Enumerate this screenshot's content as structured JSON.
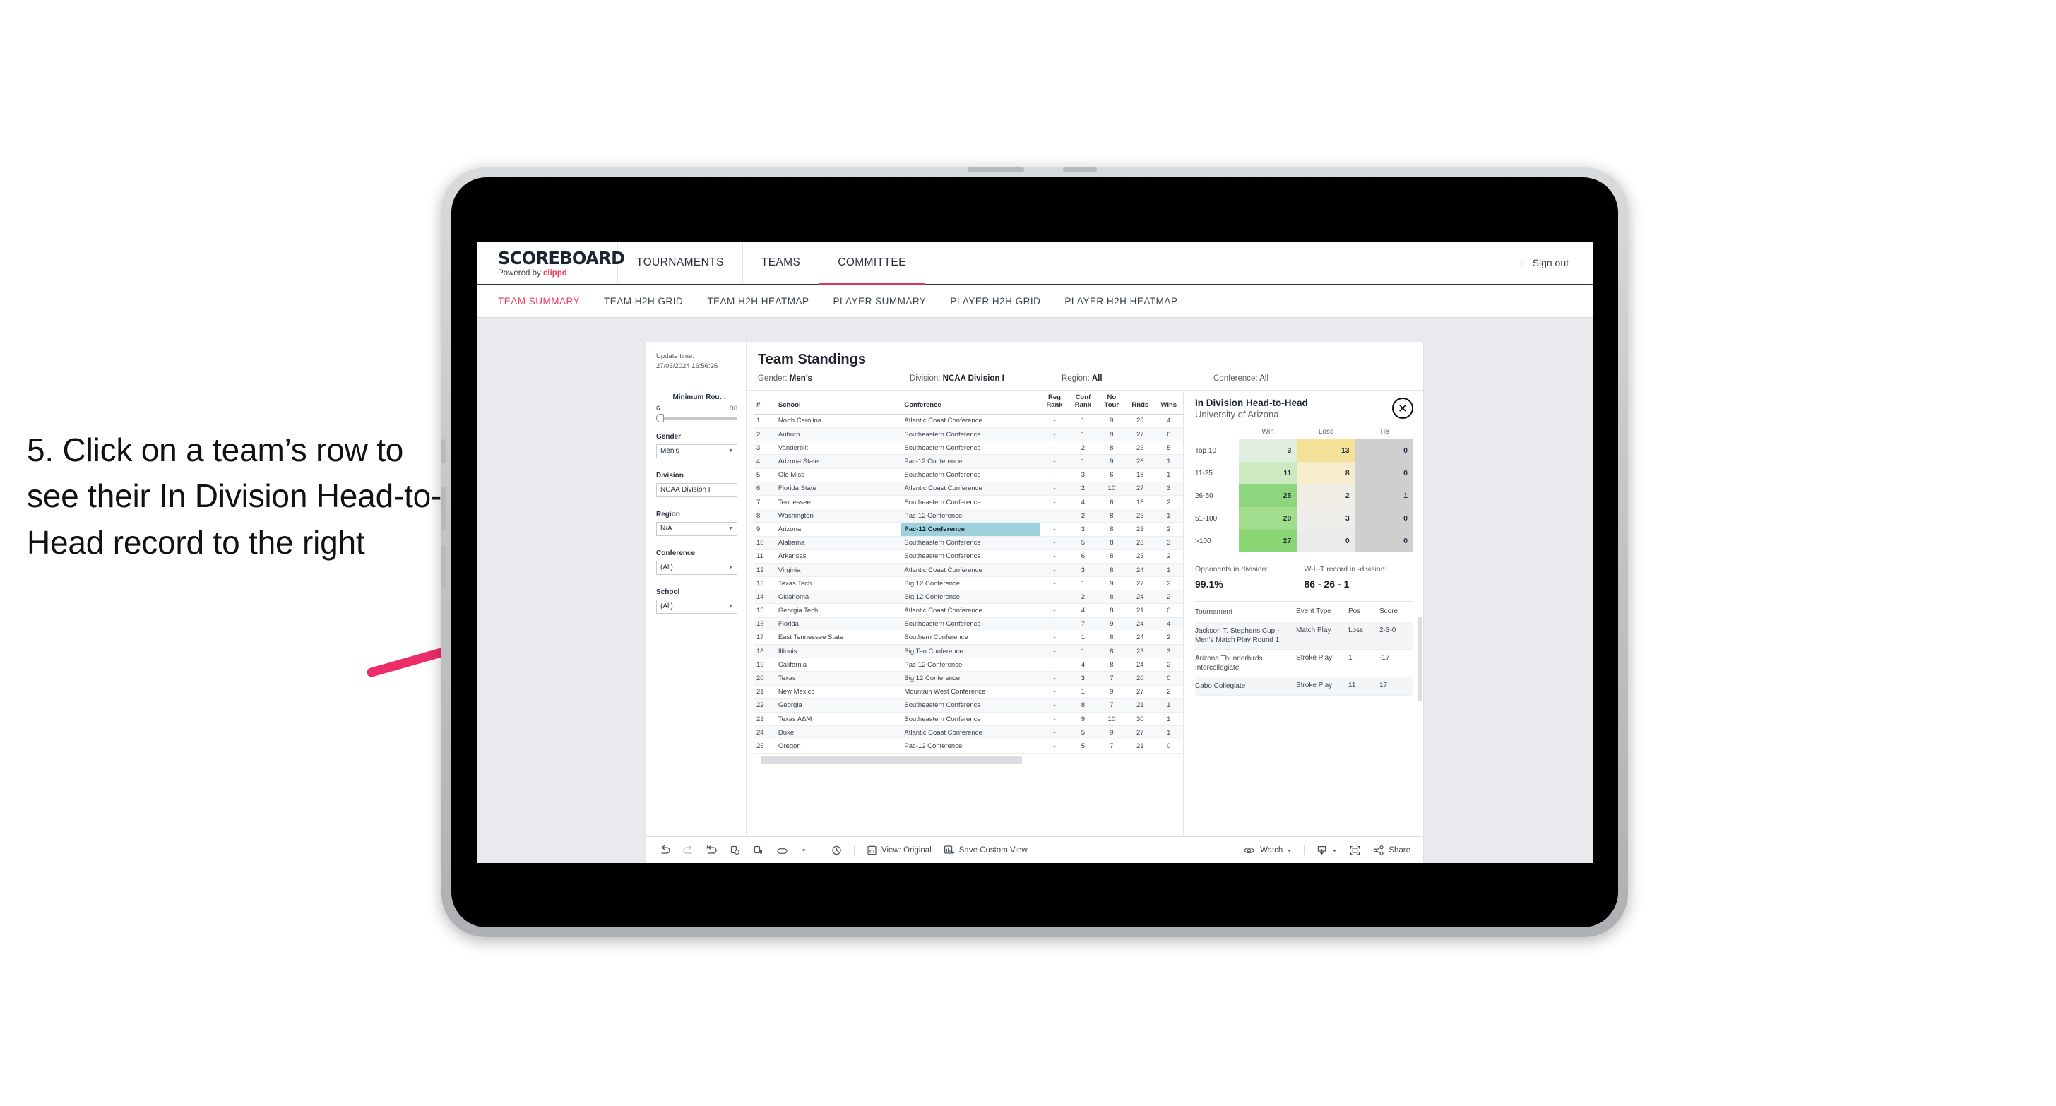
{
  "annotation": {
    "text": "5. Click on a team’s row to see their In Division Head-to-Head record to the right",
    "arrow_color": "#ee2d68"
  },
  "topnav": {
    "brand_name": "SCOREBOARD",
    "brand_sub_prefix": "Powered by ",
    "brand_sub_name": "clippd",
    "items": [
      {
        "label": "TOURNAMENTS",
        "active": false
      },
      {
        "label": "TEAMS",
        "active": false
      },
      {
        "label": "COMMITTEE",
        "active": true
      }
    ],
    "separator": "|",
    "sign_out": "Sign out",
    "accent": "#e03a58"
  },
  "subnav": {
    "items": [
      {
        "label": "TEAM SUMMARY",
        "active": true
      },
      {
        "label": "TEAM H2H GRID",
        "active": false
      },
      {
        "label": "TEAM H2H HEATMAP",
        "active": false
      },
      {
        "label": "PLAYER SUMMARY",
        "active": false
      },
      {
        "label": "PLAYER H2H GRID",
        "active": false
      },
      {
        "label": "PLAYER H2H HEATMAP",
        "active": false
      }
    ]
  },
  "sidebar": {
    "update_label": "Update time:",
    "update_value": "27/03/2024 16:56:26",
    "slider": {
      "title": "Minimum Rou…",
      "min": "6",
      "max": "30"
    },
    "filters": [
      {
        "label": "Gender",
        "value": "Men’s"
      },
      {
        "label": "Division",
        "value": "NCAA Division I"
      },
      {
        "label": "Region",
        "value": "N/A"
      },
      {
        "label": "Conference",
        "value": "(All)"
      },
      {
        "label": "School",
        "value": "(All)"
      }
    ]
  },
  "viz": {
    "title": "Team Standings",
    "filter_bar": [
      {
        "label": "Gender: ",
        "value": "Men’s",
        "bold": true
      },
      {
        "label": "Division: ",
        "value": "NCAA Division I",
        "bold": true
      },
      {
        "label": "Region: ",
        "value": "All",
        "bold": true
      },
      {
        "label": "Conference: ",
        "value": "All",
        "bold": false
      }
    ]
  },
  "table": {
    "columns": [
      "#",
      "School",
      "Conference",
      "Reg Rank",
      "Conf Rank",
      "No Tour",
      "Rnds",
      "Wins"
    ],
    "selected_row": 9,
    "rows": [
      {
        "n": "1",
        "school": "North Carolina",
        "conf": "Atlantic Coast Conference",
        "reg": "-",
        "crank": "1",
        "notour": "9",
        "rnds": "23",
        "wins": "4"
      },
      {
        "n": "2",
        "school": "Auburn",
        "conf": "Southeastern Conference",
        "reg": "-",
        "crank": "1",
        "notour": "9",
        "rnds": "27",
        "wins": "6"
      },
      {
        "n": "3",
        "school": "Vanderbilt",
        "conf": "Southeastern Conference",
        "reg": "-",
        "crank": "2",
        "notour": "8",
        "rnds": "23",
        "wins": "5"
      },
      {
        "n": "4",
        "school": "Arizona State",
        "conf": "Pac-12 Conference",
        "reg": "-",
        "crank": "1",
        "notour": "9",
        "rnds": "26",
        "wins": "1"
      },
      {
        "n": "5",
        "school": "Ole Miss",
        "conf": "Southeastern Conference",
        "reg": "-",
        "crank": "3",
        "notour": "6",
        "rnds": "18",
        "wins": "1"
      },
      {
        "n": "6",
        "school": "Florida State",
        "conf": "Atlantic Coast Conference",
        "reg": "-",
        "crank": "2",
        "notour": "10",
        "rnds": "27",
        "wins": "3"
      },
      {
        "n": "7",
        "school": "Tennessee",
        "conf": "Southeastern Conference",
        "reg": "-",
        "crank": "4",
        "notour": "6",
        "rnds": "18",
        "wins": "2"
      },
      {
        "n": "8",
        "school": "Washington",
        "conf": "Pac-12 Conference",
        "reg": "-",
        "crank": "2",
        "notour": "8",
        "rnds": "23",
        "wins": "1"
      },
      {
        "n": "9",
        "school": "Arizona",
        "conf": "Pac-12 Conference",
        "reg": "-",
        "crank": "3",
        "notour": "8",
        "rnds": "23",
        "wins": "2"
      },
      {
        "n": "10",
        "school": "Alabama",
        "conf": "Southeastern Conference",
        "reg": "-",
        "crank": "5",
        "notour": "8",
        "rnds": "23",
        "wins": "3"
      },
      {
        "n": "11",
        "school": "Arkansas",
        "conf": "Southeastern Conference",
        "reg": "-",
        "crank": "6",
        "notour": "8",
        "rnds": "23",
        "wins": "2"
      },
      {
        "n": "12",
        "school": "Virginia",
        "conf": "Atlantic Coast Conference",
        "reg": "-",
        "crank": "3",
        "notour": "8",
        "rnds": "24",
        "wins": "1"
      },
      {
        "n": "13",
        "school": "Texas Tech",
        "conf": "Big 12 Conference",
        "reg": "-",
        "crank": "1",
        "notour": "9",
        "rnds": "27",
        "wins": "2"
      },
      {
        "n": "14",
        "school": "Oklahoma",
        "conf": "Big 12 Conference",
        "reg": "-",
        "crank": "2",
        "notour": "8",
        "rnds": "24",
        "wins": "2"
      },
      {
        "n": "15",
        "school": "Georgia Tech",
        "conf": "Atlantic Coast Conference",
        "reg": "-",
        "crank": "4",
        "notour": "8",
        "rnds": "21",
        "wins": "0"
      },
      {
        "n": "16",
        "school": "Florida",
        "conf": "Southeastern Conference",
        "reg": "-",
        "crank": "7",
        "notour": "9",
        "rnds": "24",
        "wins": "4"
      },
      {
        "n": "17",
        "school": "East Tennessee State",
        "conf": "Southern Conference",
        "reg": "-",
        "crank": "1",
        "notour": "8",
        "rnds": "24",
        "wins": "2"
      },
      {
        "n": "18",
        "school": "Illinois",
        "conf": "Big Ten Conference",
        "reg": "-",
        "crank": "1",
        "notour": "8",
        "rnds": "23",
        "wins": "3"
      },
      {
        "n": "19",
        "school": "California",
        "conf": "Pac-12 Conference",
        "reg": "-",
        "crank": "4",
        "notour": "8",
        "rnds": "24",
        "wins": "2"
      },
      {
        "n": "20",
        "school": "Texas",
        "conf": "Big 12 Conference",
        "reg": "-",
        "crank": "3",
        "notour": "7",
        "rnds": "20",
        "wins": "0"
      },
      {
        "n": "21",
        "school": "New Mexico",
        "conf": "Mountain West Conference",
        "reg": "-",
        "crank": "1",
        "notour": "9",
        "rnds": "27",
        "wins": "2"
      },
      {
        "n": "22",
        "school": "Georgia",
        "conf": "Southeastern Conference",
        "reg": "-",
        "crank": "8",
        "notour": "7",
        "rnds": "21",
        "wins": "1"
      },
      {
        "n": "23",
        "school": "Texas A&M",
        "conf": "Southeastern Conference",
        "reg": "-",
        "crank": "9",
        "notour": "10",
        "rnds": "30",
        "wins": "1"
      },
      {
        "n": "24",
        "school": "Duke",
        "conf": "Atlantic Coast Conference",
        "reg": "-",
        "crank": "5",
        "notour": "9",
        "rnds": "27",
        "wins": "1"
      },
      {
        "n": "25",
        "school": "Oregon",
        "conf": "Pac-12 Conference",
        "reg": "-",
        "crank": "5",
        "notour": "7",
        "rnds": "21",
        "wins": "0"
      }
    ]
  },
  "h2h": {
    "title": "In Division Head-to-Head",
    "subtitle": "University of Arizona",
    "close_icon": "✕",
    "matrix": {
      "columns": [
        "Win",
        "Loss",
        "Tie"
      ],
      "rows": [
        {
          "label": "Top 10",
          "win": "3",
          "loss": "13",
          "tie": "0",
          "win_color": "#e0efdf",
          "loss_color": "#f2e197",
          "tie_color": "#cfcfcf"
        },
        {
          "label": "11-25",
          "win": "11",
          "loss": "8",
          "tie": "0",
          "win_color": "#cde9c2",
          "loss_color": "#f6eecb",
          "tie_color": "#cfcfcf"
        },
        {
          "label": "26-50",
          "win": "25",
          "loss": "2",
          "tie": "1",
          "win_color": "#8ed67d",
          "loss_color": "#f1eee6",
          "tie_color": "#cfcfcf"
        },
        {
          "label": "51-100",
          "win": "20",
          "loss": "3",
          "tie": "0",
          "win_color": "#a2dd8e",
          "loss_color": "#eeede9",
          "tie_color": "#cfcfcf"
        },
        {
          "label": ">100",
          "win": "27",
          "loss": "0",
          "tie": "0",
          "win_color": "#8ad674",
          "loss_color": "#ebebeb",
          "tie_color": "#cfcfcf"
        }
      ]
    },
    "stats": [
      {
        "label": "Opponents in division:",
        "value": "99.1%"
      },
      {
        "label": "W-L-T record in -division:",
        "value": "86 - 26 - 1"
      }
    ],
    "tournaments": {
      "columns": [
        "Tournament",
        "Event Type",
        "Pos",
        "Score"
      ],
      "rows": [
        {
          "name": "Jackson T. Stephens Cup - Men’s Match Play Round 1",
          "type": "Match Play",
          "pos": "Loss",
          "score": "2-3-0"
        },
        {
          "name": "Arizona Thunderbirds Intercollegiate",
          "type": "Stroke Play",
          "pos": "1",
          "score": "-17"
        },
        {
          "name": "Cabo Collegiate",
          "type": "Stroke Play",
          "pos": "11",
          "score": "17"
        }
      ]
    }
  },
  "toolbar": {
    "left_icons": [
      "undo-icon",
      "redo-icon",
      "revert-icon",
      "refresh-icon",
      "pause-icon",
      "flow-icon",
      "caret-down-icon"
    ],
    "history_icon": "history-icon",
    "view_label": "View: Original",
    "save_label": "Save Custom View",
    "watch_label": "Watch",
    "share_label": "Share",
    "download_icon": "download-icon",
    "fullscreen_icon": "fullscreen-icon"
  }
}
